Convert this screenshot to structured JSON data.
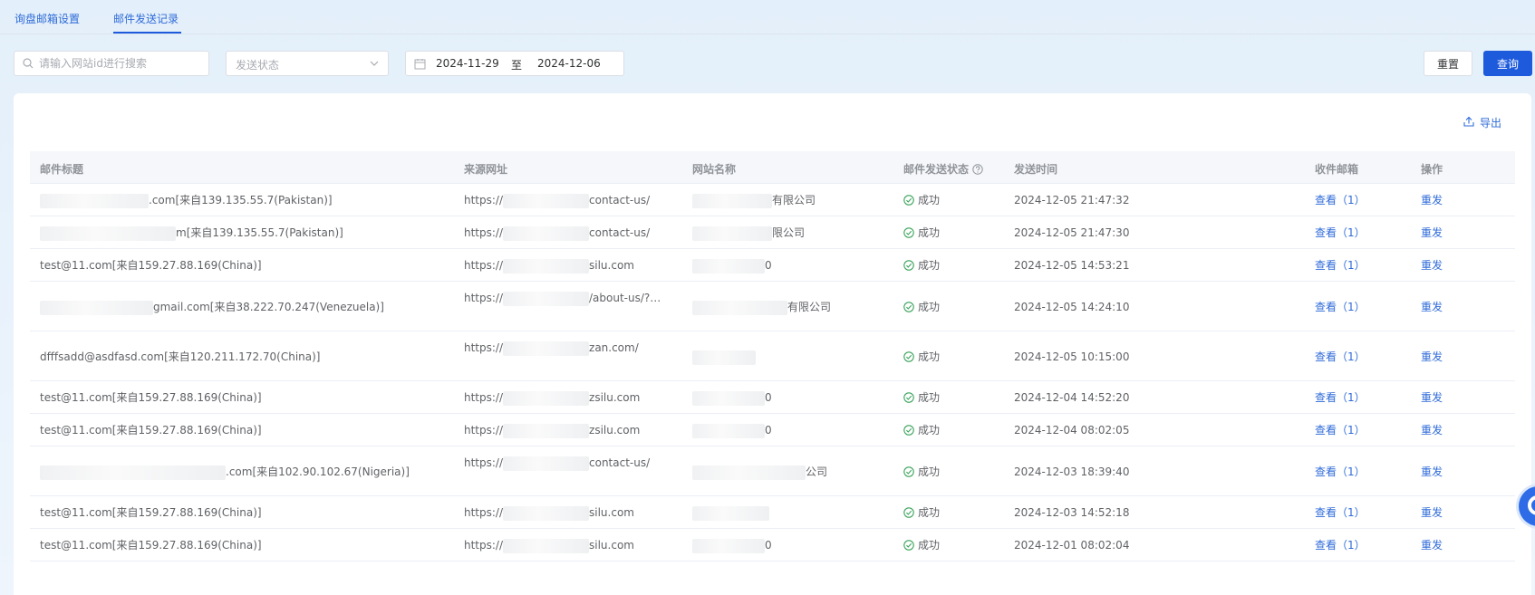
{
  "tabs": [
    {
      "label": "询盘邮箱设置",
      "active": false
    },
    {
      "label": "邮件发送记录",
      "active": true
    }
  ],
  "filters": {
    "search_placeholder": "请输入网站id进行搜索",
    "status_placeholder": "发送状态",
    "date_start": "2024-11-29",
    "date_separator": "至",
    "date_end": "2024-12-06",
    "reset_label": "重置",
    "query_label": "查询"
  },
  "toolbar": {
    "export_label": "导出"
  },
  "table": {
    "columns": {
      "title": "邮件标题",
      "url": "来源网址",
      "site": "网站名称",
      "status": "邮件发送状态",
      "time": "发送时间",
      "inbox": "收件邮箱",
      "action": "操作"
    },
    "rows": [
      {
        "title": ".com[来自139.135.55.7(Pakistan)]",
        "url_pre": "https://",
        "url_suf": "contact-us/",
        "site": "有限公司",
        "status": "成功",
        "time": "2024-12-05 21:47:32",
        "view": "查看（1）",
        "action": "重发"
      },
      {
        "title": "m[来自139.135.55.7(Pakistan)]",
        "url_pre": "https://",
        "url_suf": "contact-us/",
        "site": "限公司",
        "status": "成功",
        "time": "2024-12-05 21:47:30",
        "view": "查看（1）",
        "action": "重发"
      },
      {
        "title": "test@11.com[来自159.27.88.169(China)]",
        "url_pre": "https://",
        "url_suf": "silu.com",
        "site": "0",
        "status": "成功",
        "time": "2024-12-05 14:53:21",
        "view": "查看（1）",
        "action": "重发"
      },
      {
        "title": "gmail.com[来自38.222.70.247(Venezuela)]",
        "url_pre": "https://",
        "url_suf": "/about-us/?…",
        "site": "有限公司",
        "status": "成功",
        "time": "2024-12-05 14:24:10",
        "view": "查看（1）",
        "action": "重发"
      },
      {
        "title": "dfffsadd@asdfasd.com[来自120.211.172.70(China)]",
        "url_pre": "https://",
        "url_suf": "zan.com/",
        "site": "",
        "status": "成功",
        "time": "2024-12-05 10:15:00",
        "view": "查看（1）",
        "action": "重发"
      },
      {
        "title": "test@11.com[来自159.27.88.169(China)]",
        "url_pre": "https://",
        "url_suf": "zsilu.com",
        "site": "0",
        "status": "成功",
        "time": "2024-12-04 14:52:20",
        "view": "查看（1）",
        "action": "重发"
      },
      {
        "title": "test@11.com[来自159.27.88.169(China)]",
        "url_pre": "https://",
        "url_suf": "zsilu.com",
        "site": "0",
        "status": "成功",
        "time": "2024-12-04 08:02:05",
        "view": "查看（1）",
        "action": "重发"
      },
      {
        "title": ".com[来自102.90.102.67(Nigeria)]",
        "url_pre": "https://",
        "url_suf": "contact-us/",
        "site": "公司",
        "status": "成功",
        "time": "2024-12-03 18:39:40",
        "view": "查看（1）",
        "action": "重发"
      },
      {
        "title": "test@11.com[来自159.27.88.169(China)]",
        "url_pre": "https://",
        "url_suf": "silu.com",
        "site": "",
        "status": "成功",
        "time": "2024-12-03 14:52:18",
        "view": "查看（1）",
        "action": "重发"
      },
      {
        "title": "test@11.com[来自159.27.88.169(China)]",
        "url_pre": "https://",
        "url_suf": "silu.com",
        "site": "0",
        "status": "成功",
        "time": "2024-12-01 08:02:04",
        "view": "查看（1）",
        "action": "重发"
      }
    ]
  },
  "colors": {
    "accent": "#1e5bdc",
    "link": "#2f6bd8",
    "success": "#3aa35a"
  }
}
